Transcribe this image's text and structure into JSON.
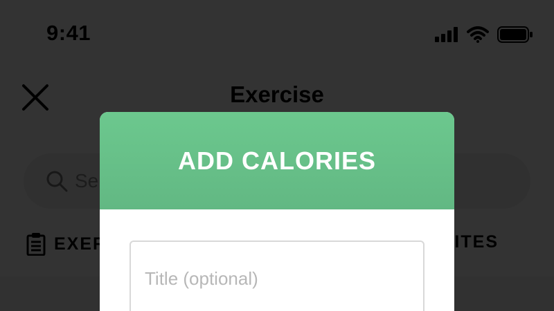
{
  "status_bar": {
    "time": "9:41"
  },
  "header": {
    "title": "Exercise"
  },
  "search": {
    "placeholder_visible": "Se"
  },
  "tabs": {
    "left_label_visible": "EXER",
    "right_label_visible": "ITES"
  },
  "modal": {
    "title": "ADD CALORIES",
    "title_field_placeholder": "Title (optional)",
    "header_color": "#6ac58c"
  },
  "icons": {
    "close": "close-icon",
    "search": "search-icon",
    "clipboard": "clipboard-icon",
    "signal": "signal-icon",
    "wifi": "wifi-icon",
    "battery": "battery-icon"
  }
}
